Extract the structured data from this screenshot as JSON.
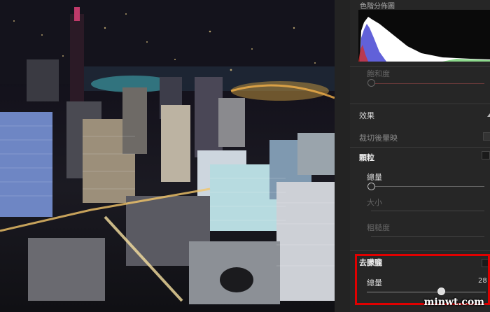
{
  "panel": {
    "histogram_title": "色階分佈圖",
    "saturation_label": "飽和度",
    "effects_label": "效果",
    "crop_vignette_label": "裁切後暈映",
    "grain_label": "顆粒",
    "grain_amount_label": "總量",
    "grain_size_label": "大小",
    "grain_roughness_label": "粗糙度",
    "dehaze_label": "去朦朧",
    "dehaze_amount_label": "總量",
    "dehaze_amount_value": "28"
  },
  "controls": {
    "grain_amount": 0,
    "dehaze_amount": 28
  },
  "watermark": "minwt.com",
  "colors": {
    "highlight_box": "#e00000",
    "panel_bg": "#262626"
  }
}
